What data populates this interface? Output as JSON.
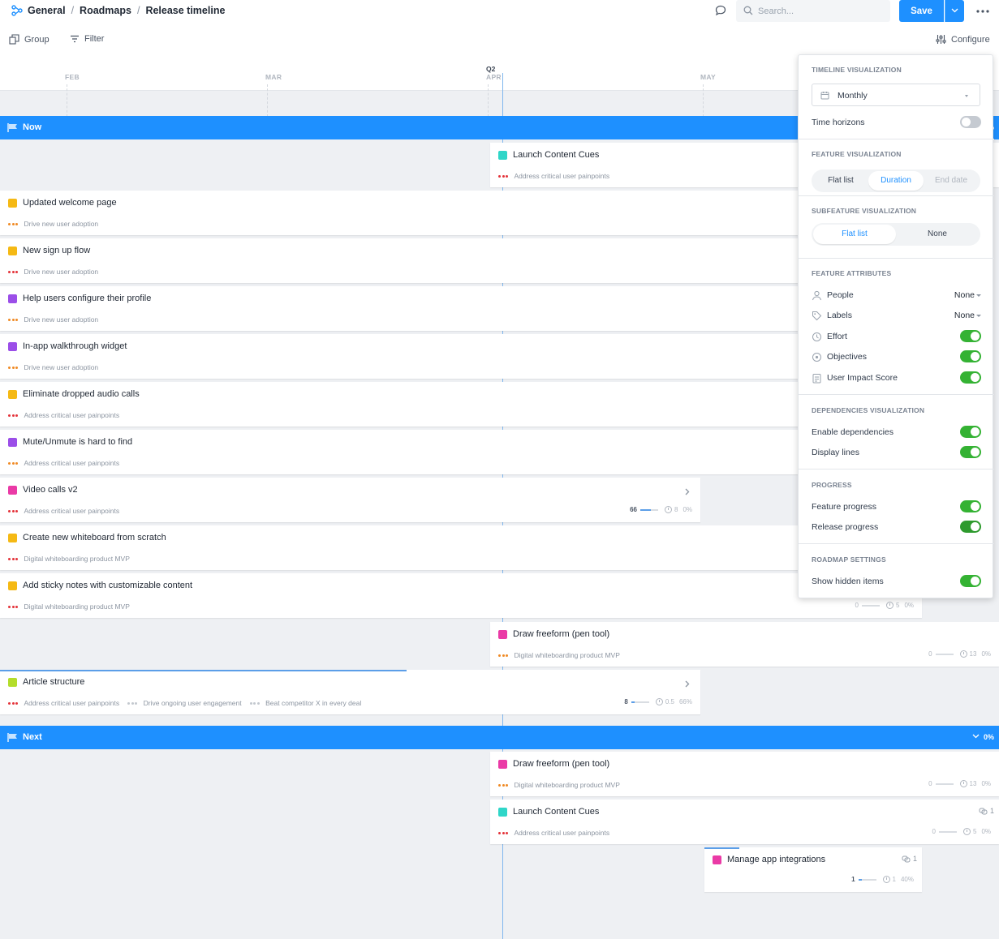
{
  "breadcrumb": [
    "General",
    "Roadmaps",
    "Release timeline"
  ],
  "search": {
    "placeholder": "Search..."
  },
  "toolbar": {
    "save_label": "Save",
    "group_label": "Group",
    "filter_label": "Filter",
    "configure_label": "Configure"
  },
  "timeline": {
    "months": [
      "FEB",
      "MAR",
      "APR",
      "MAY"
    ],
    "quarter": "Q2"
  },
  "groups": [
    {
      "label": "Now",
      "pct": "0%"
    },
    {
      "label": "Next",
      "pct": "0%"
    }
  ],
  "cards": [
    {
      "title": "Launch Content Cues",
      "color": "#2fd6c8",
      "objectives": [
        {
          "label": "Address critical user painpoints",
          "dots": "red"
        }
      ]
    },
    {
      "title": "Updated welcome page",
      "color": "#f5b914",
      "objectives": [
        {
          "label": "Drive new user adoption",
          "dots": "orange"
        }
      ]
    },
    {
      "title": "New sign up flow",
      "color": "#f5b914",
      "objectives": [
        {
          "label": "Drive new user adoption",
          "dots": "red"
        }
      ]
    },
    {
      "title": "Help users configure their profile",
      "color": "#9b4ee8",
      "objectives": [
        {
          "label": "Drive new user adoption",
          "dots": "orange"
        }
      ]
    },
    {
      "title": "In-app walkthrough widget",
      "color": "#9b4ee8",
      "objectives": [
        {
          "label": "Drive new user adoption",
          "dots": "orange"
        }
      ]
    },
    {
      "title": "Eliminate dropped audio calls",
      "color": "#f5b914",
      "objectives": [
        {
          "label": "Address critical user painpoints",
          "dots": "red"
        }
      ]
    },
    {
      "title": "Mute/Unmute is hard to find",
      "color": "#9b4ee8",
      "objectives": [
        {
          "label": "Address critical user painpoints",
          "dots": "orange"
        }
      ]
    },
    {
      "title": "Video calls v2",
      "color": "#ea3aa6",
      "objectives": [
        {
          "label": "Address critical user painpoints",
          "dots": "red"
        }
      ],
      "metrics": {
        "score": "66",
        "effort": "8",
        "progress": "0%",
        "fill": 0.6
      }
    },
    {
      "title": "Create new whiteboard from scratch",
      "color": "#f5b914",
      "objectives": [
        {
          "label": "Digital whiteboarding product MVP",
          "dots": "red"
        }
      ]
    },
    {
      "title": "Add sticky notes with customizable content",
      "color": "#f5b914",
      "objectives": [
        {
          "label": "Digital whiteboarding product MVP",
          "dots": "red"
        }
      ],
      "metrics": {
        "score": "0",
        "effort": "5",
        "progress": "0%",
        "fill": 0
      }
    },
    {
      "title": "Draw freeform (pen tool)",
      "color": "#ea3aa6",
      "objectives": [
        {
          "label": "Digital whiteboarding product MVP",
          "dots": "orange"
        }
      ],
      "metrics": {
        "score": "0",
        "effort": "13",
        "progress": "0%",
        "fill": 0
      }
    },
    {
      "title": "Article structure",
      "color": "#b3dd2b",
      "objectives": [
        {
          "label": "Address critical user painpoints",
          "dots": "red"
        },
        {
          "label": "Drive ongoing user engagement",
          "dots": "grey"
        },
        {
          "label": "Beat competitor X in every deal",
          "dots": "grey"
        }
      ],
      "metrics": {
        "score": "8",
        "effort": "0.5",
        "progress": "66%",
        "fill": 0.2
      },
      "progress": 0.66
    },
    {
      "title": "Draw freeform (pen tool)",
      "color": "#ea3aa6",
      "objectives": [
        {
          "label": "Digital whiteboarding product MVP",
          "dots": "orange"
        }
      ],
      "metrics": {
        "score": "0",
        "effort": "13",
        "progress": "0%",
        "fill": 0
      }
    },
    {
      "title": "Launch Content Cues",
      "color": "#2fd6c8",
      "objectives": [
        {
          "label": "Address critical user painpoints",
          "dots": "red"
        }
      ],
      "metrics": {
        "score": "0",
        "effort": "5",
        "progress": "0%",
        "fill": 0
      },
      "deps": "1"
    },
    {
      "title": "Manage app integrations",
      "color": "#ea3aa6",
      "objectives": [],
      "metrics": {
        "score": "1",
        "effort": "1",
        "progress": "40%",
        "fill": 0.2
      },
      "deps": "1",
      "progress": 0.4
    }
  ],
  "panel": {
    "timeline_title": "TIMELINE VISUALIZATION",
    "timeline_select": "Monthly",
    "time_horizons": "Time horizons",
    "feature_title": "FEATURE VISUALIZATION",
    "feature_opts": [
      "Flat list",
      "Duration",
      "End date"
    ],
    "subfeature_title": "SUBFEATURE VISUALIZATION",
    "subfeature_opts": [
      "Flat list",
      "None"
    ],
    "attributes_title": "FEATURE ATTRIBUTES",
    "attr_people": "People",
    "attr_labels": "Labels",
    "attr_none": "None",
    "attr_effort": "Effort",
    "attr_objectives": "Objectives",
    "attr_impact": "User Impact Score",
    "deps_title": "DEPENDENCIES VISUALIZATION",
    "deps_enable": "Enable dependencies",
    "deps_lines": "Display lines",
    "progress_title": "PROGRESS",
    "progress_feature": "Feature progress",
    "progress_release": "Release progress",
    "settings_title": "ROADMAP SETTINGS",
    "settings_hidden": "Show hidden items"
  },
  "colors": {
    "accent": "#1e90ff",
    "toggle_on": "#34b233"
  }
}
